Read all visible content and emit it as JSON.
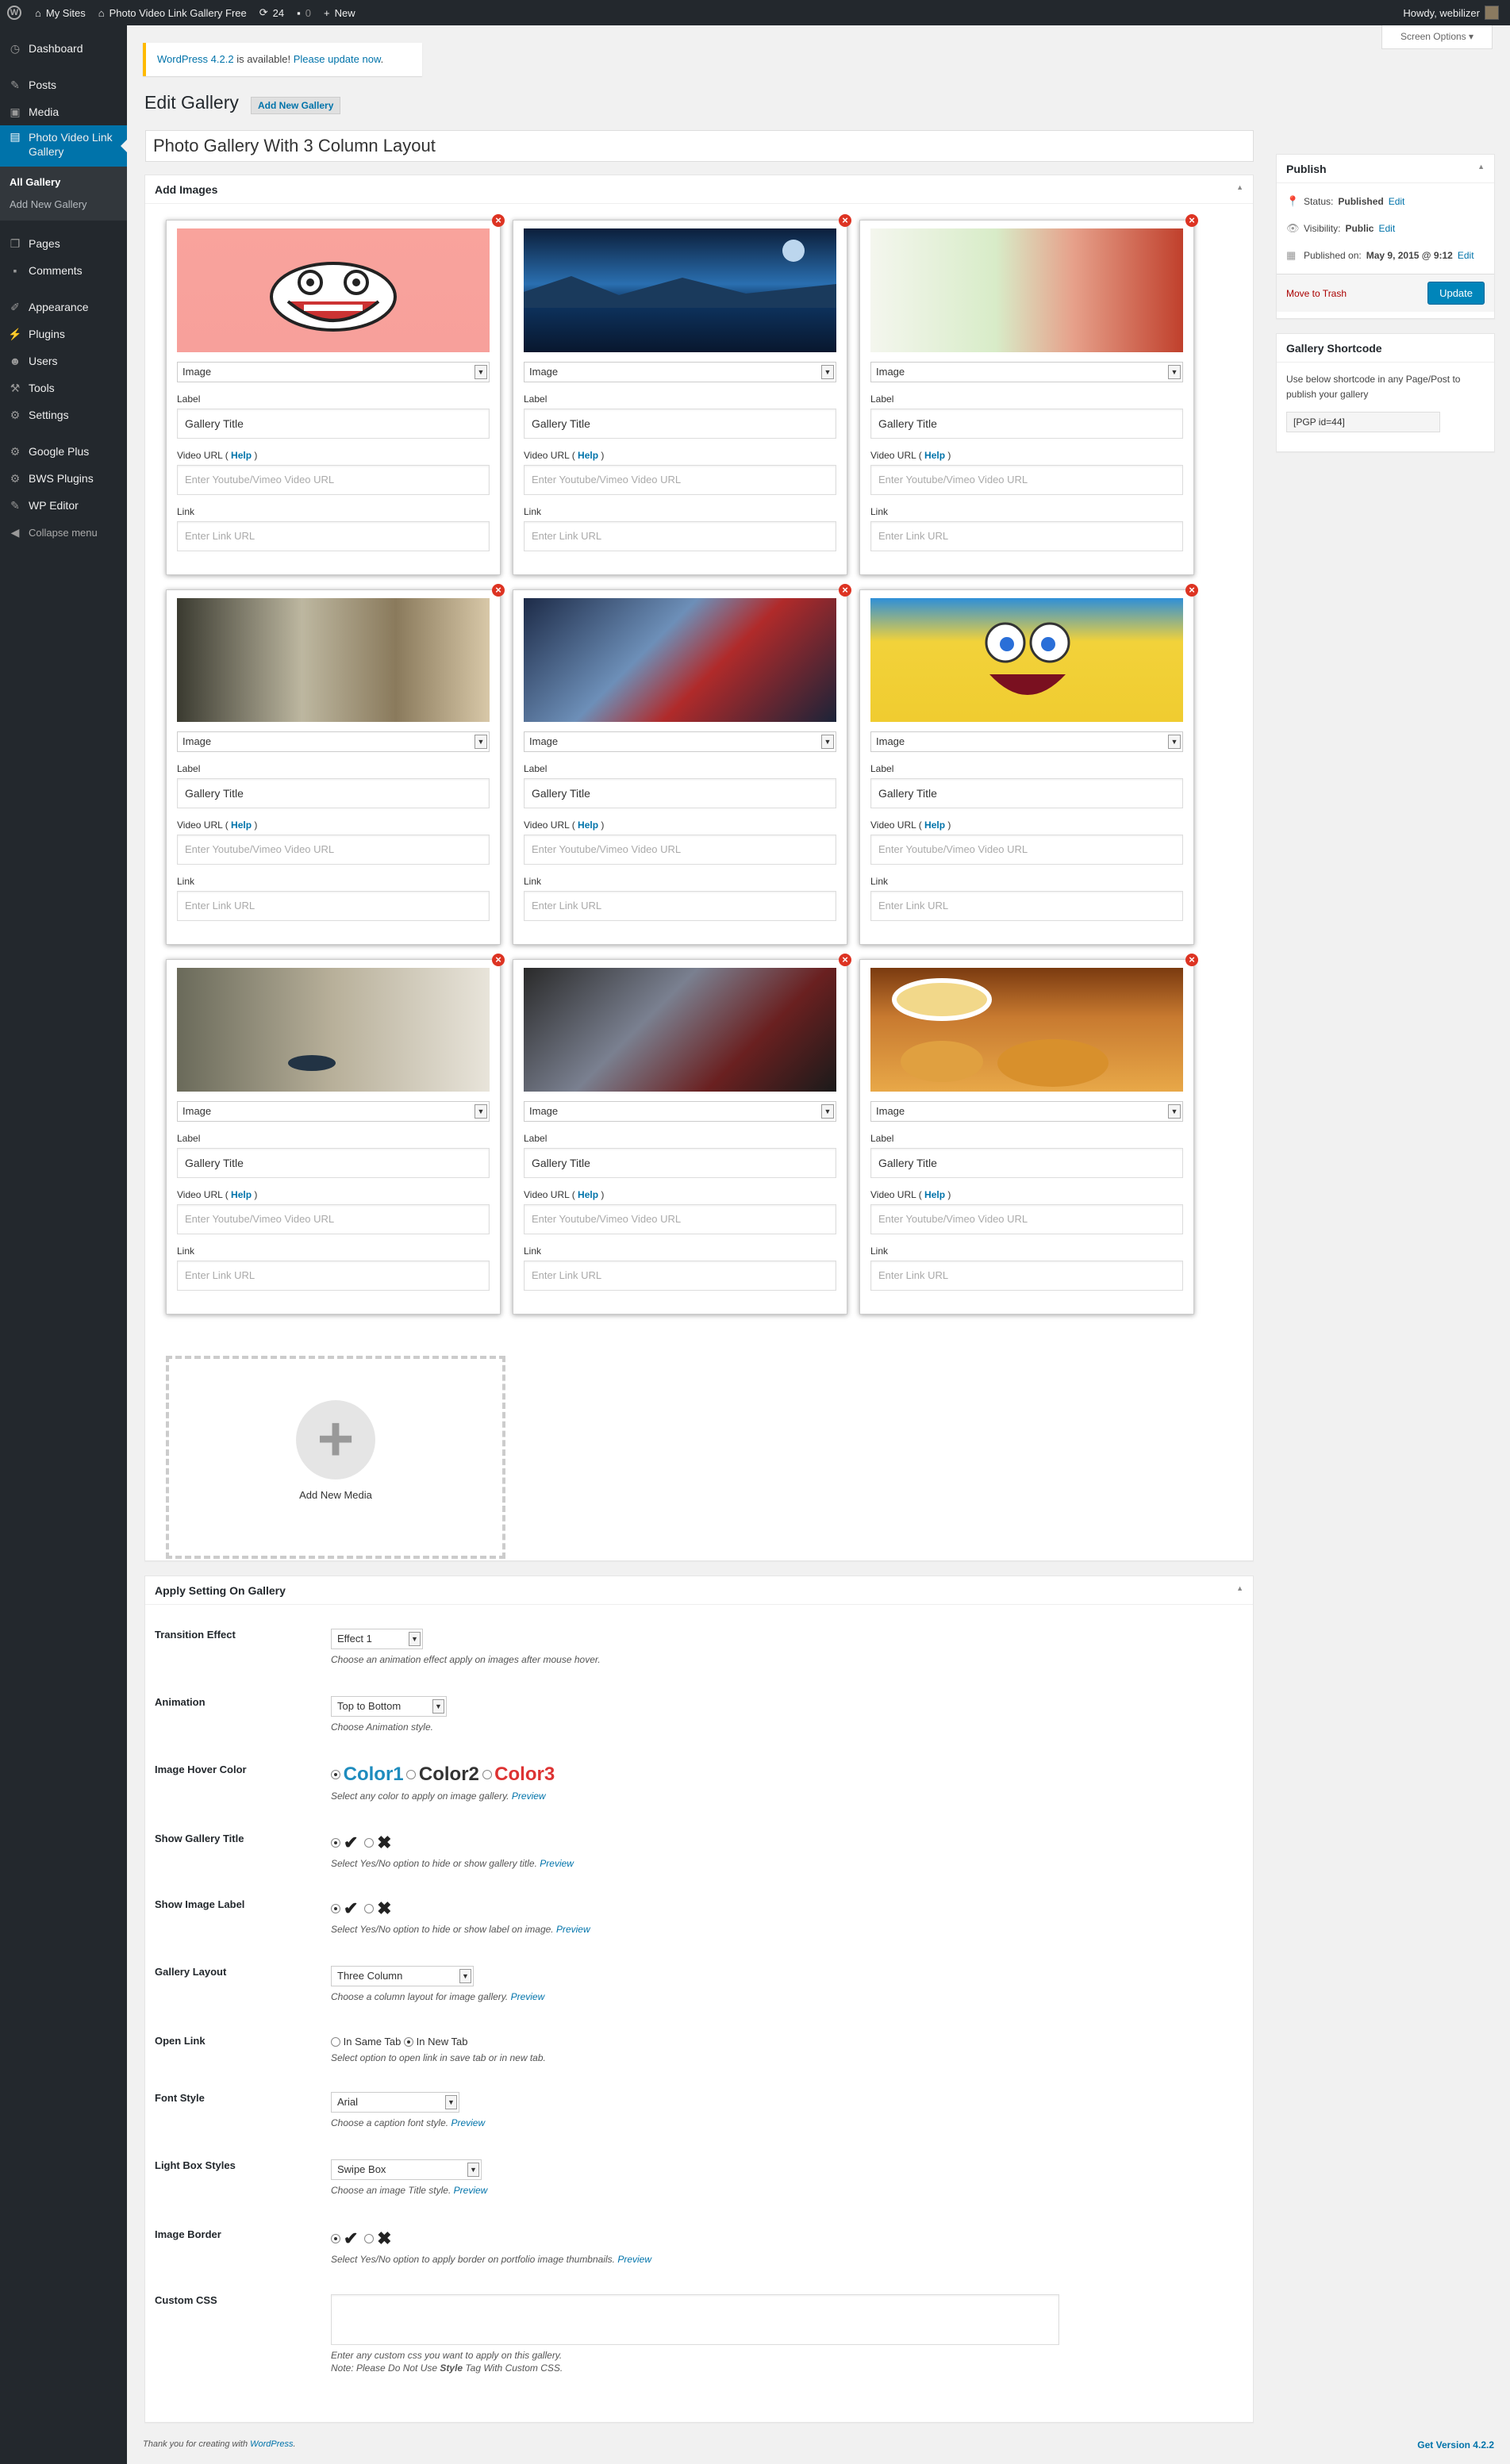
{
  "adminbar": {
    "sites": "My Sites",
    "site": "Photo Video Link Gallery Free",
    "updates": "24",
    "comments": "0",
    "new": "New",
    "howdy": "Howdy, webilizer"
  },
  "menu": {
    "dashboard": "Dashboard",
    "posts": "Posts",
    "media": "Media",
    "pvlg": "Photo Video Link Gallery",
    "all_gallery": "All Gallery",
    "add_new_gallery": "Add New Gallery",
    "pages": "Pages",
    "comments": "Comments",
    "appearance": "Appearance",
    "plugins": "Plugins",
    "users": "Users",
    "tools": "Tools",
    "settings": "Settings",
    "google_plus": "Google Plus",
    "bws": "BWS Plugins",
    "wp_editor": "WP Editor",
    "collapse": "Collapse menu"
  },
  "notice": {
    "ver": "WordPress 4.2.2",
    "mid": " is available! ",
    "link": "Please update now",
    "end": "."
  },
  "screen_options": "Screen Options ▾",
  "heading": "Edit Gallery",
  "add_new": "Add New Gallery",
  "post_title": "Photo Gallery With 3 Column Layout",
  "add_images": {
    "title": "Add Images",
    "type_label": "Image",
    "label_label": "Label",
    "label_value": "Gallery Title",
    "video_label": "Video URL ( ",
    "help": "Help",
    "video_end": " )",
    "video_ph": "Enter Youtube/Vimeo Video URL",
    "link_label": "Link",
    "link_ph": "Enter Link URL",
    "add_media": "Add New Media"
  },
  "settings": {
    "title": "Apply Setting On Gallery",
    "transition": {
      "label": "Transition Effect",
      "value": "Effect 1",
      "hint": "Choose an animation effect apply on images after mouse hover."
    },
    "animation": {
      "label": "Animation",
      "value": "Top to Bottom",
      "hint": "Choose Animation style."
    },
    "hover": {
      "label": "Image Hover Color",
      "c1": "Color1",
      "c2": "Color2",
      "c3": "Color3",
      "hint": "Select any color to apply on image gallery. ",
      "preview": "Preview",
      "colors": {
        "c1": "#1e8cbe",
        "c2": "#333333",
        "c3": "#dd3333"
      }
    },
    "show_title": {
      "label": "Show Gallery Title",
      "hint": "Select Yes/No option to hide or show gallery title. ",
      "preview": "Preview"
    },
    "show_label": {
      "label": "Show Image Label",
      "hint": "Select Yes/No option to hide or show label on image. ",
      "preview": "Preview"
    },
    "layout": {
      "label": "Gallery Layout",
      "value": "Three Column",
      "hint": "Choose a column layout for image gallery. ",
      "preview": "Preview"
    },
    "open_link": {
      "label": "Open Link",
      "same": "In Same Tab",
      "new": "In New Tab",
      "hint": "Select option to open link in save tab or in new tab."
    },
    "font": {
      "label": "Font Style",
      "value": "Arial",
      "hint": "Choose a caption font style. ",
      "preview": "Preview"
    },
    "lightbox": {
      "label": "Light Box Styles",
      "value": "Swipe Box",
      "hint": "Choose an image Title style. ",
      "preview": "Preview"
    },
    "border": {
      "label": "Image Border",
      "hint": "Select Yes/No option to apply border on portfolio image thumbnails. ",
      "preview": "Preview"
    },
    "css": {
      "label": "Custom CSS",
      "hint1": "Enter any custom css you want to apply on this gallery.",
      "hint2a": "Note: Please Do Not Use ",
      "hint2b": "Style",
      "hint2c": " Tag With Custom CSS."
    }
  },
  "publish": {
    "title": "Publish",
    "status_l": "Status: ",
    "status_v": "Published",
    "edit": "Edit",
    "vis_l": "Visibility: ",
    "vis_v": "Public",
    "pub_l": "Published on: ",
    "pub_v": "May 9, 2015 @ 9:12",
    "trash": "Move to Trash",
    "update": "Update"
  },
  "shortcode": {
    "title": "Gallery Shortcode",
    "desc": "Use below shortcode in any Page/Post to publish your gallery",
    "code": "[PGP id=44]"
  },
  "footer": {
    "thanks": "Thank you for creating with ",
    "wp": "WordPress",
    "end": ".",
    "version": "Get Version 4.2.2"
  }
}
